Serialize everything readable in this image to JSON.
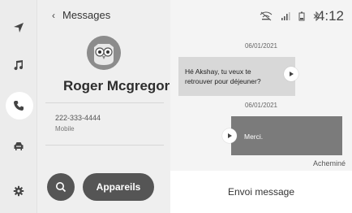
{
  "nav": {
    "items": [
      {
        "icon": "navigation-arrow-icon"
      },
      {
        "icon": "music-note-icon"
      },
      {
        "icon": "phone-icon",
        "active": true
      },
      {
        "icon": "car-icon"
      },
      {
        "icon": "settings-gear-icon"
      }
    ]
  },
  "header": {
    "back_label": "Messages"
  },
  "contact": {
    "name": "Roger Mcgregor",
    "phone": "222-333-4444",
    "phone_type": "Mobile"
  },
  "actions": {
    "devices_label": "Appareils"
  },
  "status_bar": {
    "time": "4:12"
  },
  "messages": [
    {
      "date": "06/01/2021",
      "direction": "incoming",
      "text_line1": "Hé Akshay, tu veux te",
      "text_line2": "retrouver pour déjeuner?"
    },
    {
      "date": "06/01/2021",
      "direction": "outgoing",
      "text": "Merci."
    }
  ],
  "receipt": "Acheminé",
  "send_label": "Envoi message",
  "colors": {
    "outgoing_bubble": "#7b7b7b",
    "incoming_bubble": "#d8d8d8",
    "button_dark": "#555555"
  }
}
